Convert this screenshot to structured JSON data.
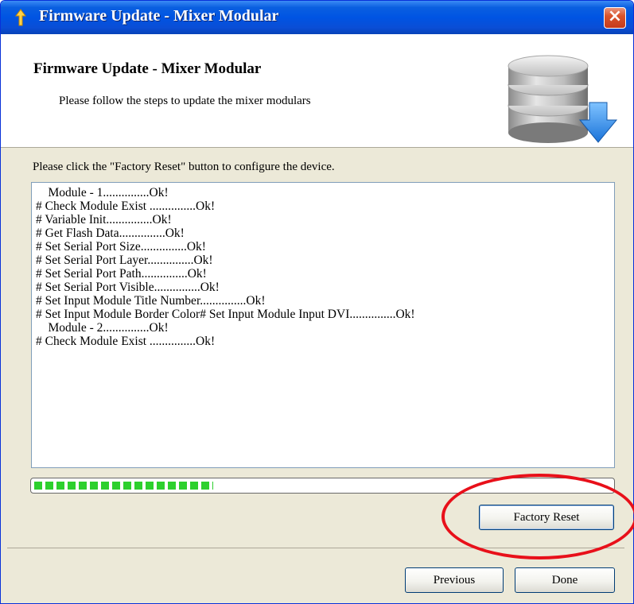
{
  "window": {
    "title": "Firmware Update - Mixer Modular",
    "close_label": "×"
  },
  "header": {
    "title": "Firmware Update - Mixer Modular",
    "subtitle": "Please follow the steps to update the mixer modulars"
  },
  "instruction": "Please click the \"Factory Reset\" button to configure the device.",
  "log": {
    "lines": [
      "    Module - 1...............Ok!",
      "# Check Module Exist ...............Ok!",
      "# Variable Init...............Ok!",
      "# Get Flash Data...............Ok!",
      "# Set Serial Port Size...............Ok!",
      "# Set Serial Port Layer...............Ok!",
      "# Set Serial Port Path...............Ok!",
      "# Set Serial Port Visible...............Ok!",
      "# Set Input Module Title Number...............Ok!",
      "# Set Input Module Border Color# Set Input Module Input DVI...............Ok!",
      "    Module - 2...............Ok!",
      "# Check Module Exist ...............Ok!"
    ]
  },
  "progress": {
    "value": 0.31,
    "color": "#2dd02d"
  },
  "buttons": {
    "factory_reset": "Factory Reset",
    "previous": "Previous",
    "done": "Done"
  },
  "annotation": {
    "color": "#e8101a"
  },
  "icons": {
    "app": "update-arrow-icon",
    "header": "database-download-icon"
  }
}
